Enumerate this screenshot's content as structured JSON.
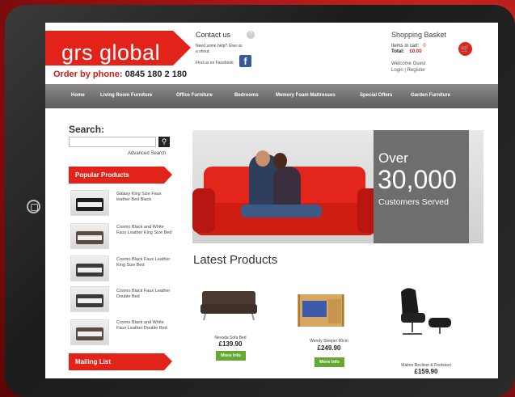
{
  "header": {
    "logo": "grs global",
    "phone_label": "Order by phone:",
    "phone_number": "0845 180 2 180",
    "contact_title": "Contact us",
    "help_text": "Need some help? Give us a shout.",
    "facebook_text": "Find us on Facebook",
    "basket_title": "Shopping Basket",
    "items_label": "Items in cart:",
    "items_value": "0",
    "total_label": "Total:",
    "total_value": "£0.00",
    "welcome": "Welcome Guest",
    "login_register": "Login | Register"
  },
  "nav": [
    "Home",
    "Living Room Furniture",
    "Office Furniture",
    "Bedrooms",
    "Memory Foam Mattresses",
    "Special Offers",
    "Garden Furniture"
  ],
  "sidebar": {
    "search_label": "Search:",
    "advanced_search": "Advanced Search",
    "popular_title": "Popular Products",
    "products": [
      "Galaxy King Size Faux leather Bed Black",
      "Cosmo Black and White Faux Leather King Size Bed",
      "Cosmo Black Faux Leather King Size Bed",
      "Cosmo Black Faux Leather Double Bed",
      "Cosmo Black and White Faux Leather Double Bed"
    ],
    "mailing_title": "Mailing List"
  },
  "banner": {
    "over": "Over",
    "number": "30,000",
    "subtitle": "Customers Served"
  },
  "latest": {
    "title": "Latest Products",
    "items": [
      {
        "name": "Nevada Sofa Bed",
        "price": "£139.90",
        "button": "More Info"
      },
      {
        "name": "Wendy Sleeper 90cm",
        "price": "£249.90",
        "button": "More Info"
      },
      {
        "name": "Malmo Recliner & Footstool",
        "price": "£159.90"
      }
    ]
  },
  "colors": {
    "brand_red": "#e2231a",
    "nav_grey": "#6e6e6e",
    "button_green": "#66a834"
  }
}
